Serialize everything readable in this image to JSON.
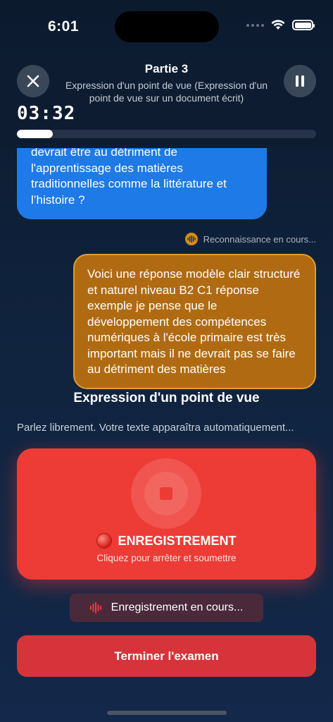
{
  "status_bar": {
    "time": "6:01"
  },
  "header": {
    "title": "Partie 3",
    "subtitle": "Expression d'un point de vue (Expression d'un point de vue sur un document écrit)",
    "timer": "03:32",
    "progress_fraction": 0.12
  },
  "chat": {
    "question_text": "devrait être au détriment de l'apprentissage des matières traditionnelles comme la littérature et l’histoire ?",
    "recognition_text": "Reconnaissance en cours...",
    "answer_text": "Voici une réponse modèle clair structuré et naturel niveau B2 C1 réponse exemple je pense que le développement des compétences numériques à l'école primaire est très important mais il ne devrait pas se faire au détriment des matières"
  },
  "section": {
    "title": "Expression d'un point de vue",
    "hint": "Parlez librement. Votre texte apparaîtra automatiquement..."
  },
  "record": {
    "label": "ENREGISTREMENT",
    "sub": "Cliquez pour arrêter et soumettre"
  },
  "rec_status": "Enregistrement en cours...",
  "finish_button": "Terminer l'examen",
  "colors": {
    "question_bubble": "#1e7ae6",
    "answer_bubble": "#b06b12",
    "record_card": "#ed3b36",
    "finish_button": "#d6343a"
  }
}
